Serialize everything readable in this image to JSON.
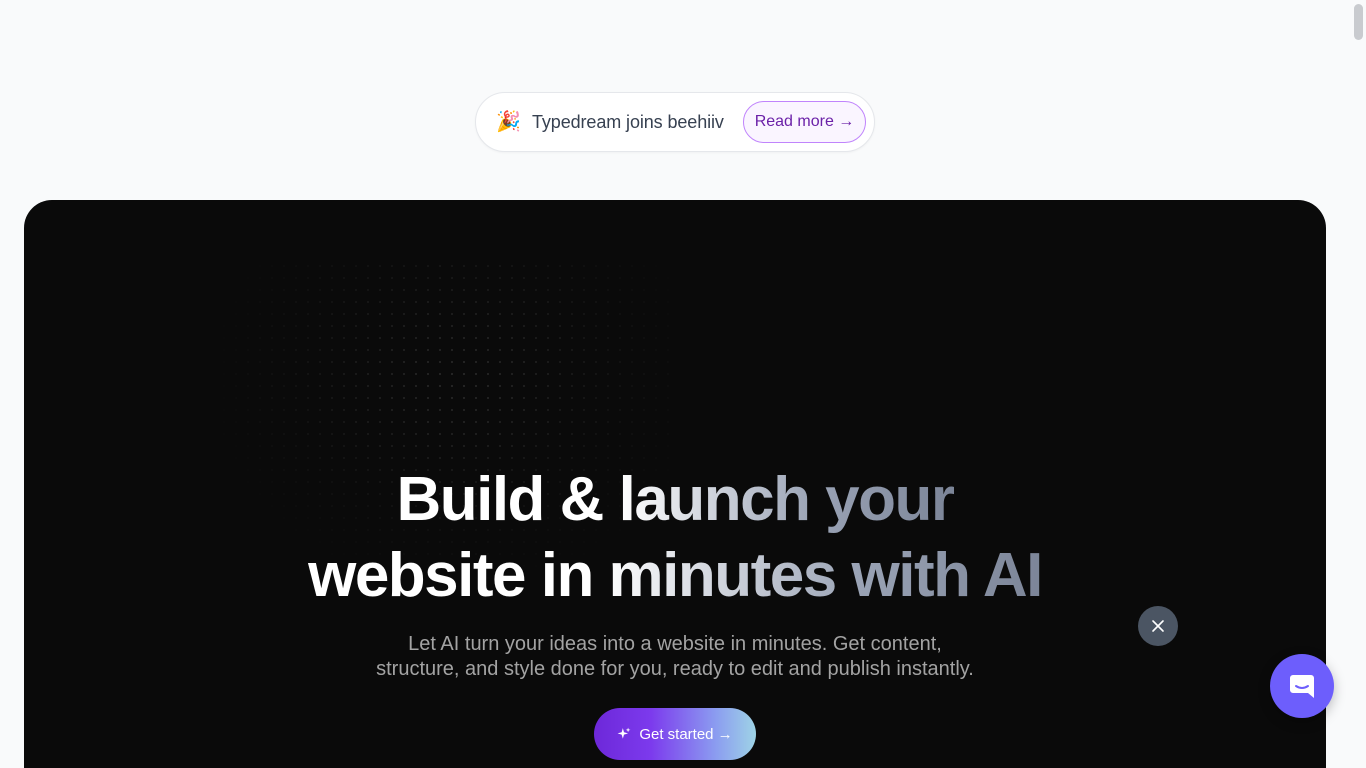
{
  "announcement": {
    "emoji": "🎉",
    "text": "Typedream joins beehiiv",
    "link_label": "Read more →"
  },
  "hero": {
    "headline_line1": "Build & launch your",
    "headline_line2": "website in minutes with AI",
    "subtitle_line1": "Let AI turn your ideas into a website in minutes. Get content,",
    "subtitle_line2": "structure, and style done for you, ready to edit and publish instantly.",
    "cta_label": "Get started →"
  },
  "widgets": {
    "close_icon": "close-icon",
    "chat_icon": "chat-icon"
  },
  "colors": {
    "hero_bg": "#0a0a0a",
    "accent_purple": "#6d28d9",
    "chat_button": "#6d5efc"
  }
}
